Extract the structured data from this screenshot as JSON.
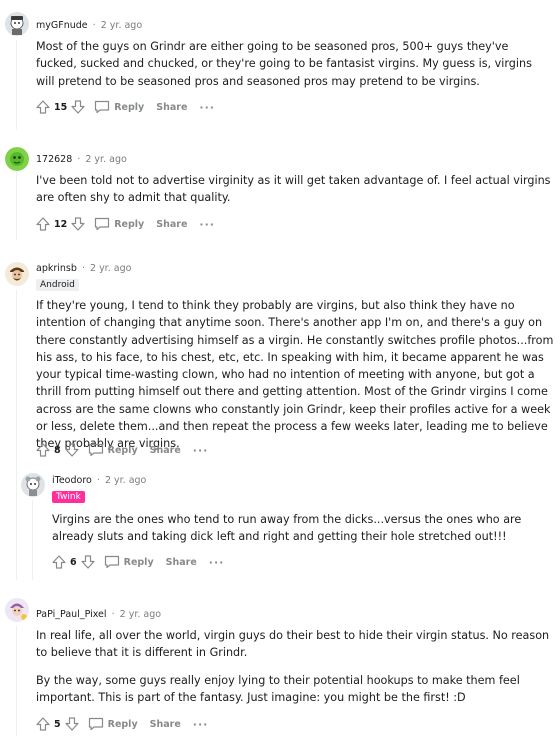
{
  "comments": [
    {
      "author": "myGFnude",
      "age": "2 yr. ago",
      "paragraphs": [
        "Most of the guys on Grindr are either going to be seasoned pros, 500+ guys they've fucked, sucked and chucked, or they're going to be fantasist virgins. My guess is, virgins will pretend to be seasoned pros and seasoned pros may pretend to be virgins."
      ],
      "score": "15",
      "reply_label": "Reply",
      "share_label": "Share",
      "more_label": "···"
    },
    {
      "author": "172628",
      "age": "2 yr. ago",
      "paragraphs": [
        "I've been told not to advertise virginity as it will get taken advantage of. I feel actual virgins are often shy to admit that quality."
      ],
      "score": "12",
      "reply_label": "Reply",
      "share_label": "Share",
      "more_label": "···"
    },
    {
      "author": "apkrinsb",
      "age": "2 yr. ago",
      "flair": "Android",
      "paragraphs": [
        "If they're young, I tend to think they probably are virgins, but also think they have no intention of changing that anytime soon. There's another app I'm on, and there's a guy on there constantly advertising himself as a virgin. He constantly switches profile photos...from his ass, to his face, to his chest, etc, etc. In speaking with him, it became apparent he was your typical time-wasting clown, who had no intention of meeting with anyone, but got a thrill from putting himself out there and getting attention. Most of the Grindr virgins I come across are the same clowns who constantly join Grindr, keep their profiles active for a week or less, delete them...and then repeat the process a few weeks later, leading me to believe they probably are virgins."
      ],
      "score": "8",
      "reply_label": "Reply",
      "share_label": "Share",
      "more_label": "···"
    },
    {
      "author": "iTeodoro",
      "age": "2 yr. ago",
      "flair": "Twink",
      "paragraphs": [
        "Virgins are the ones who tend to run away from the dicks...versus the ones who are already sluts and taking dick left and right and getting their hole stretched out!!!"
      ],
      "score": "6",
      "reply_label": "Reply",
      "share_label": "Share",
      "more_label": "···"
    },
    {
      "author": "PaPi_Paul_Pixel",
      "age": "2 yr. ago",
      "paragraphs": [
        "In real life, all over the world, virgin guys do their best to hide their virgin status. No reason to believe that it is different in Grindr.",
        "By the way, some guys really enjoy lying to their potential hookups to make them feel important. This is part of the fantasy. Just imagine: you might be the first! :D"
      ],
      "score": "5",
      "reply_label": "Reply",
      "share_label": "Share",
      "more_label": "···"
    }
  ],
  "colors": {
    "flair_twink": "#ff2e9a",
    "flair_android": "#edeff1",
    "meta_gray": "#7c7c7c",
    "action_gray": "#878a8c"
  },
  "icons": [
    "upvote-icon",
    "downvote-icon",
    "comment-bubble-icon",
    "more-options-icon"
  ]
}
